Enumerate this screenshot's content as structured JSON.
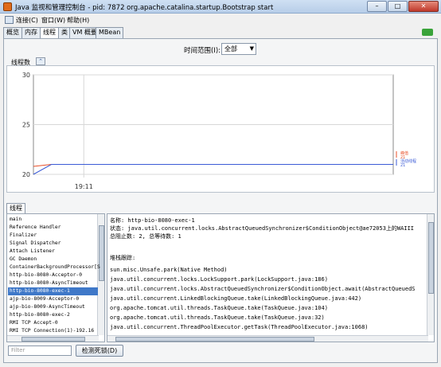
{
  "window": {
    "title": "Java 监视和管理控制台 - pid: 7872 org.apache.catalina.startup.Bootstrap start",
    "minimize": "–",
    "maximize": "□",
    "close": "✕"
  },
  "menu": {
    "items": [
      "连接(C)",
      "窗口(W)",
      "帮助(H)"
    ]
  },
  "tabs": [
    "概览",
    "内存",
    "线程",
    "类",
    "VM 概要",
    "MBean"
  ],
  "active_tab": "线程",
  "time_range": {
    "label": "时间范围(I):",
    "selected": "全部"
  },
  "chart_section": {
    "label": "线程数",
    "collapse_icon": "chevron-up-double-icon"
  },
  "chart_data": {
    "type": "line",
    "title": "",
    "xlabel": "",
    "ylabel": "",
    "ylim": [
      20,
      30
    ],
    "yticks": [
      20,
      25,
      30
    ],
    "xticks": [
      "19:11"
    ],
    "grid": true,
    "series": [
      {
        "name": "峰值",
        "color": "#e8502a",
        "points": [
          [
            0,
            20.8
          ],
          [
            0.05,
            21
          ],
          [
            1,
            21
          ]
        ]
      },
      {
        "name": "活动线程",
        "color": "#3b5bd6",
        "points": [
          [
            0,
            20
          ],
          [
            0.05,
            21
          ],
          [
            1,
            21
          ]
        ]
      }
    ],
    "legend": {
      "position": "right",
      "entries": [
        {
          "label": "峰值",
          "value": "21"
        },
        {
          "label": "活动线程",
          "value": "21"
        }
      ]
    }
  },
  "threads_tab": "线程",
  "threads": [
    "main",
    "Reference Handler",
    "Finalizer",
    "Signal Dispatcher",
    "Attach Listener",
    "GC Daemon",
    "ContainerBackgroundProcessor[S",
    "http-bio-8080-Acceptor-0",
    "http-bio-8080-AsyncTimeout",
    "http-bio-8080-exec-1",
    "ajp-bio-8009-Acceptor-0",
    "ajp-bio-8009-AsyncTimeout",
    "http-bio-8080-exec-2",
    "RMI TCP Accept-0",
    "RMI TCP Connection(1)-192.16"
  ],
  "selected_thread": "http-bio-8080-exec-1",
  "detail": {
    "lines": [
      "名称: http-bio-8080-exec-1",
      "状态: java.util.concurrent.locks.AbstractQueuedSynchronizer$ConditionObject@ae72053上的WAIII",
      "总阻止数: 2, 总等待数: 1",
      "",
      "堆栈跟踪:",
      "sun.misc.Unsafe.park(Native Method)",
      "java.util.concurrent.locks.LockSupport.park(LockSupport.java:186)",
      "java.util.concurrent.locks.AbstractQueuedSynchronizer$ConditionObject.await(AbstractQueuedS",
      "java.util.concurrent.LinkedBlockingQueue.take(LinkedBlockingQueue.java:442)",
      "org.apache.tomcat.util.threads.TaskQueue.take(TaskQueue.java:104)",
      "org.apache.tomcat.util.threads.TaskQueue.take(TaskQueue.java:32)",
      "java.util.concurrent.ThreadPoolExecutor.getTask(ThreadPoolExecutor.java:1068)"
    ]
  },
  "filter": {
    "placeholder": "Filter"
  },
  "detect_button": "检测死锁(D)"
}
